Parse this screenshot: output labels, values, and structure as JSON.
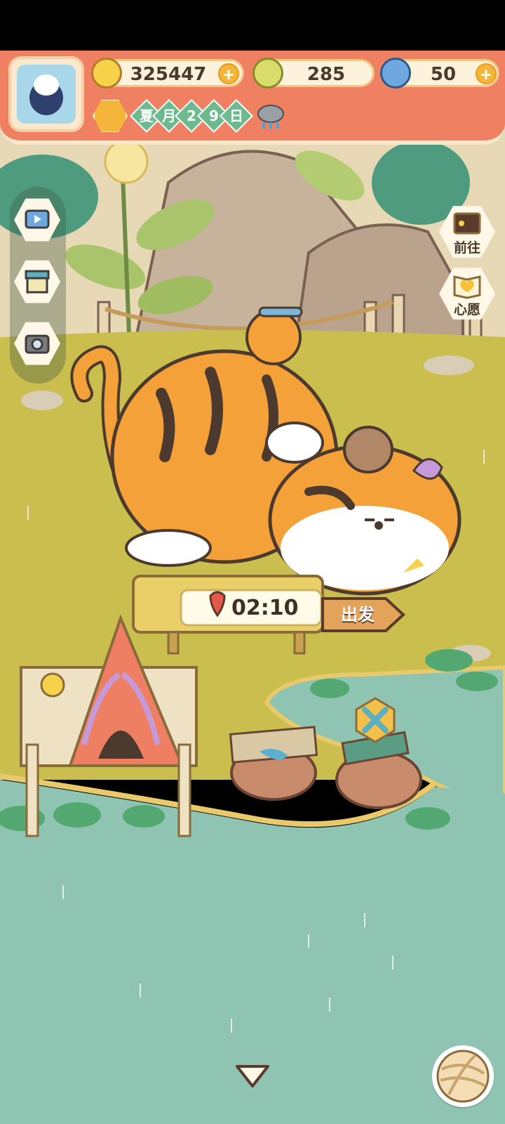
{
  "hud": {
    "bananas": "325447",
    "clovers": "285",
    "blue_bananas": "50",
    "plus_symbol": "+",
    "date": [
      "夏",
      "月",
      "2",
      "9",
      "日"
    ],
    "weather_icon": "rain-cloud-icon"
  },
  "side_menu_left": [
    {
      "icon": "tv-icon"
    },
    {
      "icon": "shop-icon"
    },
    {
      "icon": "camera-icon"
    }
  ],
  "side_menu_right": [
    {
      "icon": "board-icon",
      "label": "前往"
    },
    {
      "icon": "heart-book-icon",
      "label": "心愿"
    }
  ],
  "expedition": {
    "timer": "02:10",
    "go_label": "出发"
  },
  "colors": {
    "hud_red": "#f08062",
    "grass": "#c9be4e",
    "water": "#8fc4b2",
    "tiger_orange": "#f4a13a"
  },
  "bottom": {
    "collapse_icon": "triangle-down-icon",
    "yarn_icon": "yarn-ball-icon"
  }
}
